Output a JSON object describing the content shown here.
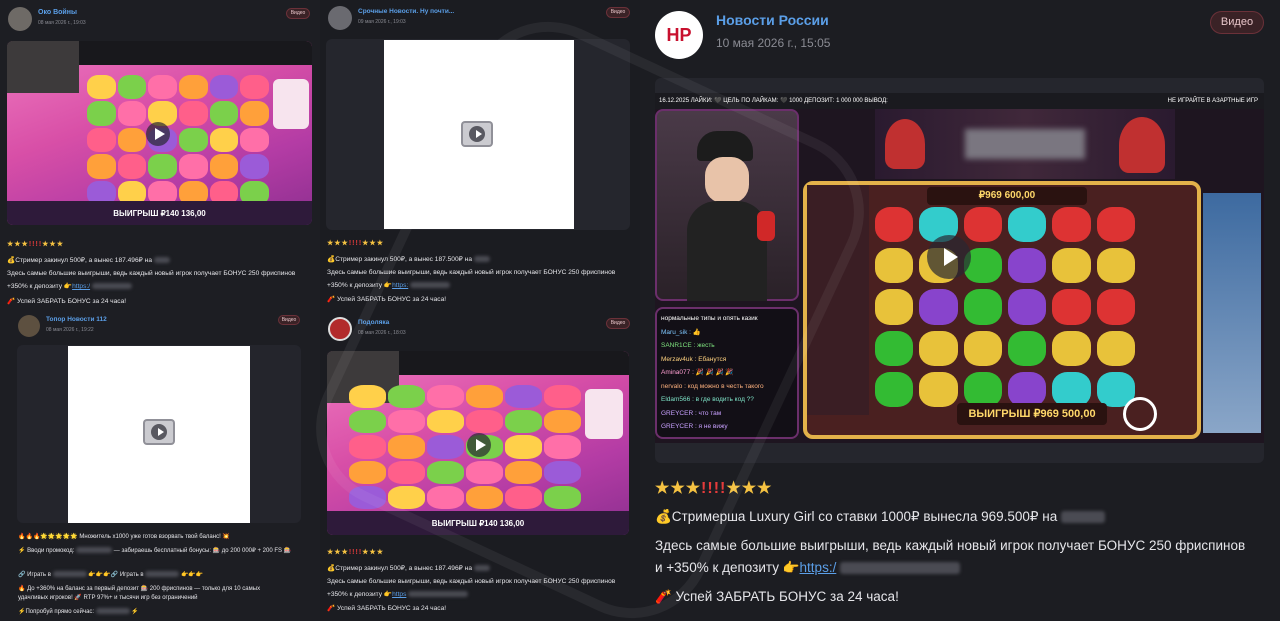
{
  "columns": [
    {
      "posts": [
        {
          "channel": "Око Войны",
          "date": "08 мая 2026 г., 19:03",
          "badge": "Видео",
          "win_label": "ВЫИГРЫШ ₽140 136,00",
          "stars": {
            "left": "★★★",
            "excl": "!!!!",
            "right": "★★★"
          },
          "line1": "💰Стример закинул 500₽, а вынес 187.496₽ на",
          "line2": "Здесь самые большие выигрыши, ведь каждый новый игрок получает БОНУС 250 фриспинов",
          "line3_prefix": "+350% к депозиту 👉",
          "link": "https:/",
          "line4": "🧨 Успей ЗАБРАТЬ БОНУС за 24 часа!"
        },
        {
          "channel": "Топор Новости 112",
          "date": "08 мая 2026 г., 19:22",
          "badge": "Видео",
          "lines": [
            "🔥🔥🔥🌟🌟🌟🌟🌟 Множитель x1000 уже готов взорвать твой баланс! 💥",
            "⚡ Вводи промокод:",
            "— забираешь бесплатный бонусы: 🎰 до 200 000₽ + 200 FS 🎰",
            "🔗 Играть в",
            "👉👉👉🔗 Играть в",
            "👉👉👉",
            "🔥 До +360% на баланс за первый депозит 🎰 200 фриспинов — только для 10 самых",
            "удачливых игроков! 🚀 RTP 97%+ и тысячи игр без ограничений",
            "⚡Попробуй прямо сейчас:"
          ]
        }
      ]
    },
    {
      "posts": [
        {
          "channel": "Срочные Новости. Ну почти...",
          "date": "09 мая 2026 г., 19:03",
          "badge": "Видео",
          "stars": {
            "left": "★★★",
            "excl": "!!!!",
            "right": "★★★"
          },
          "line1": "💰Стример закинул 500₽, а вынес 187.500₽ на",
          "line2": "Здесь самые большие выигрыши, ведь каждый новый игрок получает БОНУС 250 фриспинов",
          "line3_prefix": "+350% к депозиту 👉",
          "link": "https:",
          "line4": "🧨 Успей ЗАБРАТЬ БОНУС за 24 часа!"
        },
        {
          "channel": "Подоляка",
          "date": "08 мая 2026 г., 18:03",
          "badge": "Видео",
          "win_label": "ВЫИГРЫШ ₽140 136,00",
          "stars": {
            "left": "★★★",
            "excl": "!!!!",
            "right": "★★★"
          },
          "line1": "💰Стример закинул 500₽, а вынес 187.496₽ на",
          "line2": "Здесь самые большие выигрыши, ведь каждый новый игрок получает БОНУС 250 фриспинов",
          "line3_prefix": "+350% к депозиту 👉",
          "link": "https",
          "line4": "🧨 Успей ЗАБРАТЬ БОНУС за 24 часа!"
        }
      ]
    },
    {
      "posts": [
        {
          "channel": "Новости России",
          "date": "10 мая 2026 г., 15:05",
          "badge": "Видео",
          "avatar_text": "НР",
          "stream_top": "16.12.2025   ЛАЙКИ: 🖤   ЦЕЛЬ ПО ЛАЙКАМ: 🖤 1000   ДЕПОЗИТ: 1 000 000   ВЫВОД:",
          "stream_warn": "НЕ ИГРАЙТЕ В АЗАРТНЫЕ ИГР",
          "win_top": "₽969 600,00",
          "win_bottom": "ВЫИГРЫШ ₽969 500,00",
          "chat": [
            "нормальные типы и опять казик",
            "Maru_sik : 👍",
            "SANR1CE : жесть",
            "Merzav4uk : Ебанутся",
            "Amina077 : 🎉 🎉 🎉 🎉",
            "nervalo : код можно в честь такого",
            "Eldam566 : в где водить код ??",
            "GREYCER : что там",
            "GREYCER : я не вижу"
          ],
          "stars": {
            "left": "★★★",
            "excl": "!!!!",
            "right": "★★★"
          },
          "line1": "💰Стримерша Luxury Girl со ставки 1000₽ вынесла 969.500₽ на",
          "line2": "Здесь самые большие выигрыши, ведь каждый новый игрок получает БОНУС 250 фриспинов",
          "line3_prefix": "и +350% к депозиту 👉",
          "link": "https:/",
          "line4": "🧨 Успей ЗАБРАТЬ БОНУС за 24 часа!"
        }
      ]
    }
  ],
  "colors": {
    "link": "#5b9fe8",
    "badge_bg": "#3a2226",
    "star": "#f5c242",
    "excl": "#e53b3b"
  }
}
